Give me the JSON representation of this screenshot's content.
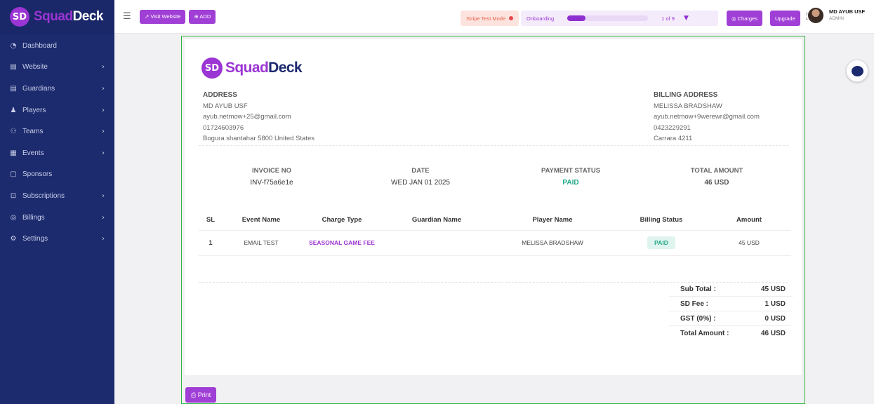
{
  "brand": {
    "badge": "SD",
    "name_a": "Squad",
    "name_b": "Deck"
  },
  "sidebar": {
    "items": [
      {
        "icon": "◔",
        "label": "Dashboard",
        "chevron": ""
      },
      {
        "icon": "▤",
        "label": "Website",
        "chevron": "›"
      },
      {
        "icon": "▤",
        "label": "Guardians",
        "chevron": "›"
      },
      {
        "icon": "♟",
        "label": "Players",
        "chevron": "›"
      },
      {
        "icon": "⚇",
        "label": "Teams",
        "chevron": "›"
      },
      {
        "icon": "▦",
        "label": "Events",
        "chevron": "›"
      },
      {
        "icon": "▢",
        "label": "Sponsors",
        "chevron": ""
      },
      {
        "icon": "⊡",
        "label": "Subscriptions",
        "chevron": "›"
      },
      {
        "icon": "◎",
        "label": "Billings",
        "chevron": "›"
      },
      {
        "icon": "⚙",
        "label": "Settings",
        "chevron": "›"
      }
    ]
  },
  "topbar": {
    "hamburger": "☰",
    "visit_label": "↗ Visit Website",
    "add_label": "⊕ ADD",
    "stripe_label": "Stripe Test Mode",
    "onboarding_label": "Onboarding",
    "onboarding_progress": 0.22,
    "page_indicator": "1 of 9",
    "page_chevron": "▼",
    "charges_label": "◎ Charges",
    "upgrade_label": "Upgrade",
    "fullscreen_icon": "⛶",
    "user_name": "MD AYUB USF",
    "user_role": "ADMIN"
  },
  "invoice": {
    "logo_badge": "SD",
    "logo_a": "Squad",
    "logo_b": "Deck",
    "address": {
      "heading": "ADDRESS",
      "name": "MD AYUB USF",
      "email": "ayub.netmow+25@gmail.com",
      "phone": "01724603976",
      "location": "Bogura shantahar 5800 United States"
    },
    "billing": {
      "heading": "BILLING ADDRESS",
      "name": "MELISSA BRADSHAW",
      "email": "ayub.netmow+9werewr@gmail.com",
      "phone": "0423229291",
      "location": "Carrara 4211"
    },
    "meta": {
      "invoice_label": "INVOICE NO",
      "invoice_value": "INV-f75a6e1e",
      "date_label": "DATE",
      "date_value": "WED JAN 01 2025",
      "status_label": "PAYMENT STATUS",
      "status_value": "PAID",
      "total_label": "TOTAL AMOUNT",
      "total_value": "46 USD"
    },
    "table": {
      "headers": [
        "SL",
        "Event Name",
        "Charge Type",
        "Guardian Name",
        "Player Name",
        "Billing Status",
        "Amount"
      ],
      "row": {
        "sl": "1",
        "event": "EMAIL TEST",
        "charge": "SEASONAL GAME FEE",
        "guardian": "",
        "player": "MELISSA BRADSHAW",
        "status": "PAID",
        "amount": "45 USD"
      }
    },
    "totals": {
      "sub_label": "Sub Total :",
      "sub_value": "45 USD",
      "fee_label": "SD Fee :",
      "fee_value": "1 USD",
      "gst_label": "GST (0%) :",
      "gst_value": "0 USD",
      "total_label": "Total Amount :",
      "total_value": "46 USD"
    },
    "print_label": "⎙ Print"
  },
  "colors": {
    "sidebar": "#1c2a6e",
    "accent": "#9b35d4",
    "paid": "#22a889",
    "frame": "#2fb43e"
  }
}
